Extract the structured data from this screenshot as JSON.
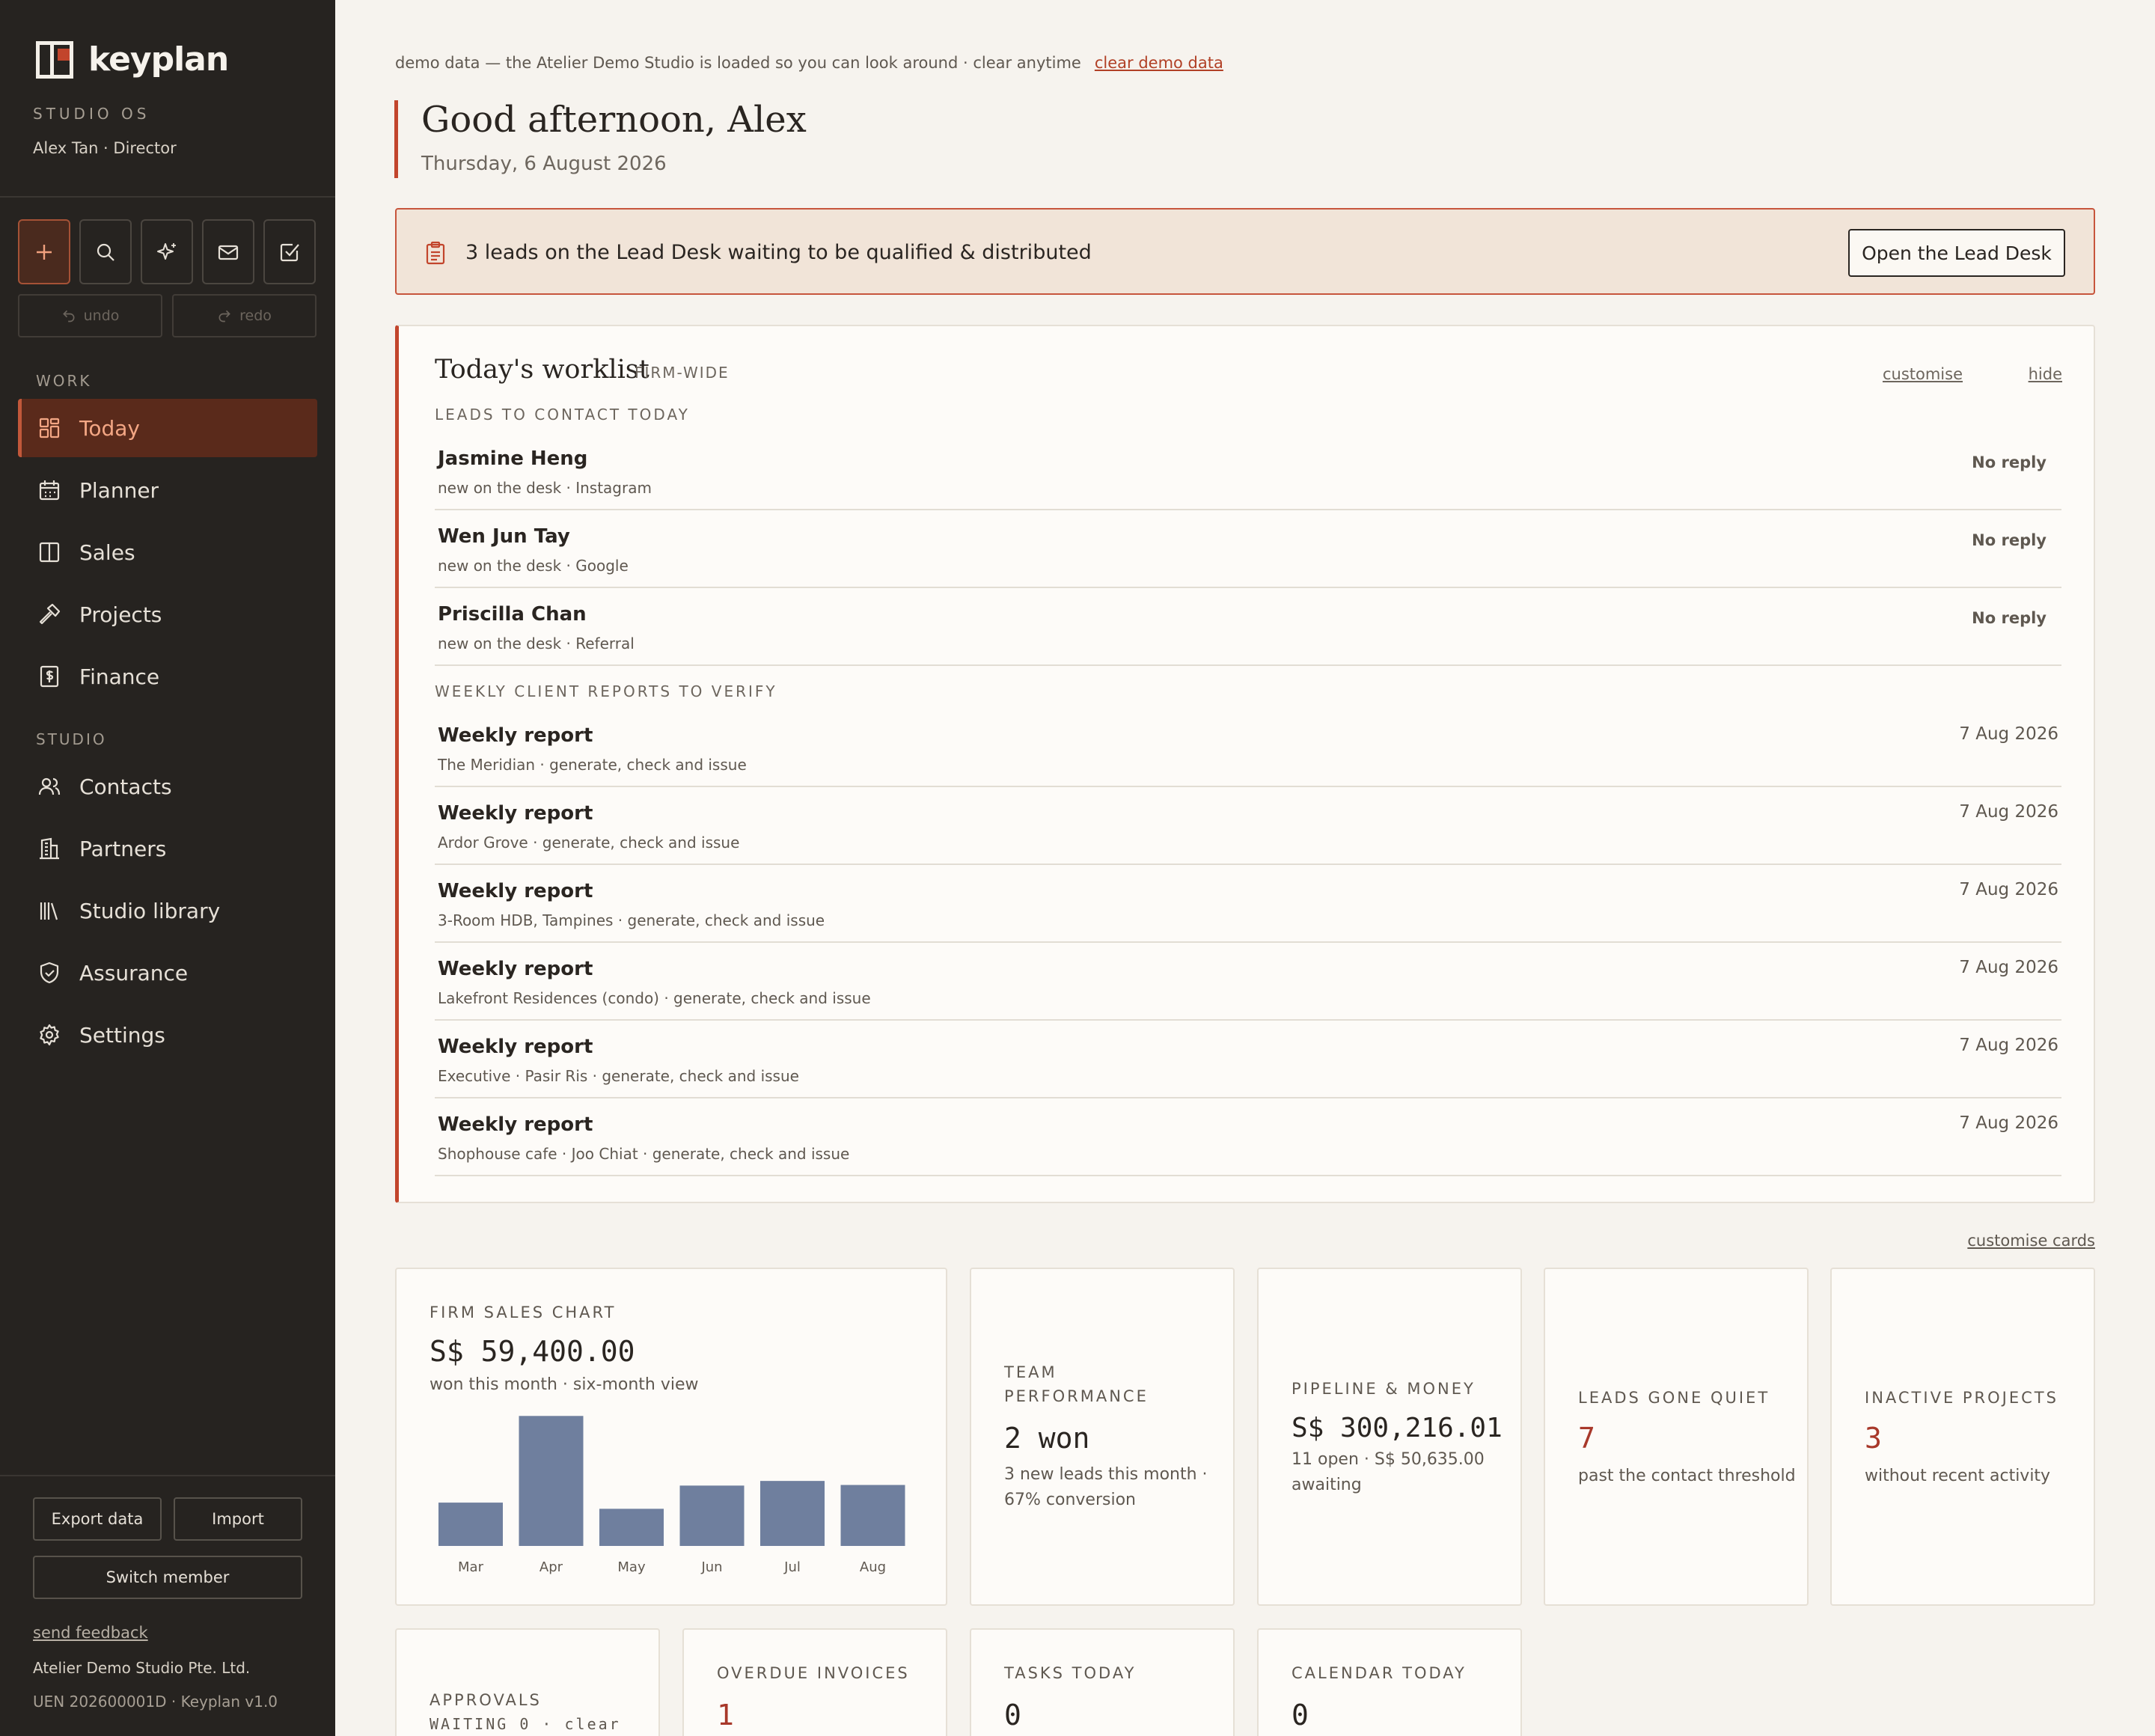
{
  "app": {
    "brand": "keyplan",
    "product": "STUDIO OS",
    "user": "Alex Tan · Director"
  },
  "toolbar": {
    "undo_label": "undo",
    "redo_label": "redo"
  },
  "nav": {
    "work_label": "WORK",
    "studio_label": "STUDIO",
    "work_items": [
      {
        "label": "Today",
        "icon": "grid-icon",
        "active": true
      },
      {
        "label": "Planner",
        "icon": "calendar-icon"
      },
      {
        "label": "Sales",
        "icon": "columns-icon"
      },
      {
        "label": "Projects",
        "icon": "hammer-icon"
      },
      {
        "label": "Finance",
        "icon": "dollar-icon"
      }
    ],
    "studio_items": [
      {
        "label": "Contacts",
        "icon": "people-icon"
      },
      {
        "label": "Partners",
        "icon": "building-icon"
      },
      {
        "label": "Studio library",
        "icon": "library-icon"
      },
      {
        "label": "Assurance",
        "icon": "shield-icon"
      },
      {
        "label": "Settings",
        "icon": "gear-icon"
      }
    ]
  },
  "sidebar_footer": {
    "export_label": "Export data",
    "import_label": "Import",
    "switch_label": "Switch member",
    "feedback_label": "send feedback",
    "company": "Atelier Demo Studio Pte. Ltd.",
    "uen": "UEN 202600001D · Keyplan v1.0"
  },
  "header": {
    "demo_text": "demo data — the Atelier Demo Studio is loaded so you can look around · clear anytime",
    "demo_link": "clear demo data",
    "greeting": "Good afternoon, Alex",
    "date": "Thursday, 6 August 2026"
  },
  "lead_banner": {
    "text": "3 leads on the Lead Desk waiting to be qualified & distributed",
    "button": "Open the Lead Desk"
  },
  "worklist": {
    "title": "Today's worklist",
    "tag": "FIRM-WIDE",
    "customise": "customise",
    "hide": "hide",
    "leads_heading": "LEADS TO CONTACT TODAY",
    "leads": [
      {
        "name": "Jasmine Heng",
        "sub": "new on the desk · Instagram",
        "status": "No reply"
      },
      {
        "name": "Wen Jun Tay",
        "sub": "new on the desk · Google",
        "status": "No reply"
      },
      {
        "name": "Priscilla Chan",
        "sub": "new on the desk · Referral",
        "status": "No reply"
      }
    ],
    "reports_heading": "WEEKLY CLIENT REPORTS TO VERIFY",
    "reports": [
      {
        "title": "Weekly report",
        "sub": "The Meridian · generate, check and issue",
        "date": "7 Aug 2026"
      },
      {
        "title": "Weekly report",
        "sub": "Ardor Grove · generate, check and issue",
        "date": "7 Aug 2026"
      },
      {
        "title": "Weekly report",
        "sub": "3-Room HDB, Tampines · generate, check and issue",
        "date": "7 Aug 2026"
      },
      {
        "title": "Weekly report",
        "sub": "Lakefront Residences (condo) · generate, check and issue",
        "date": "7 Aug 2026"
      },
      {
        "title": "Weekly report",
        "sub": "Executive · Pasir Ris · generate, check and issue",
        "date": "7 Aug 2026"
      },
      {
        "title": "Weekly report",
        "sub": "Shophouse cafe · Joo Chiat · generate, check and issue",
        "date": "7 Aug 2026"
      }
    ]
  },
  "cards": {
    "customise_label": "customise cards",
    "sales": {
      "label": "FIRM SALES CHART",
      "value": "S$ 59,400.00",
      "sub": "won this month · six-month view"
    },
    "team": {
      "label_1": "TEAM",
      "label_2": "PERFORMANCE",
      "value": "2 won",
      "sub_1": "3 new leads this month ·",
      "sub_2": "67% conversion"
    },
    "pipeline": {
      "label": "PIPELINE & MONEY",
      "value": "S$ 300,216.01",
      "sub_1": "11 open · S$ 50,635.00",
      "sub_2": "awaiting"
    },
    "quiet": {
      "label": "LEADS GONE QUIET",
      "value": "7",
      "sub": "past the contact threshold"
    },
    "inactive": {
      "label": "INACTIVE PROJECTS",
      "value": "3",
      "sub": "without recent activity"
    },
    "approvals": {
      "label_1": "APPROVALS",
      "label_2": "WAITING 0 · clear"
    },
    "overdue": {
      "label": "OVERDUE INVOICES",
      "value": "1"
    },
    "tasks": {
      "label": "TASKS TODAY",
      "value": "0"
    },
    "calendar": {
      "label": "CALENDAR TODAY",
      "value": "0"
    }
  },
  "chart_data": {
    "type": "bar",
    "categories": [
      "Mar",
      "Apr",
      "May",
      "Jun",
      "Jul",
      "Aug"
    ],
    "values": [
      14000,
      42000,
      12000,
      19500,
      21000,
      19700
    ],
    "ylim": [
      0,
      44000
    ],
    "grid": false,
    "color": "#6f7f9e"
  },
  "colors": {
    "accent": "#c2452c",
    "sidebar_bg": "#262320",
    "active_nav_bg": "#5a2a1b",
    "alert_number": "#a8382a",
    "bar": "#6f7f9e"
  }
}
